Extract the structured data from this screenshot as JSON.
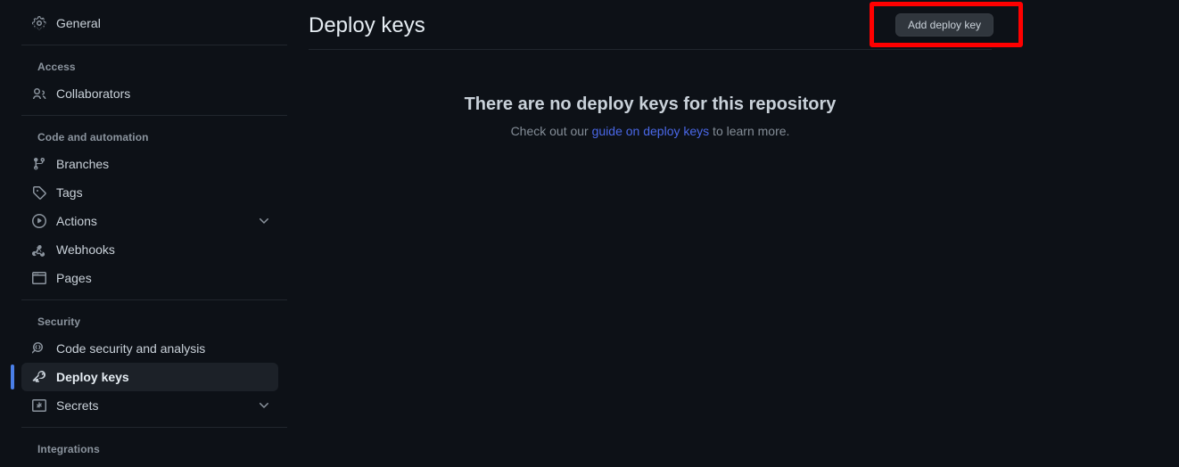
{
  "theme": {
    "background": "#0d1117",
    "selected_background": "#1c2128",
    "accent_bar": "#4a7fe8",
    "link": "#4a68e8",
    "button_background": "#30363d",
    "highlight_border": "#ff0000",
    "border": "#21262d",
    "text_primary": "#e6edf3",
    "text_muted": "#8b949e"
  },
  "sidebar": {
    "sections": [
      {
        "title": null,
        "items": [
          {
            "label": "General",
            "icon": "gear-icon",
            "name": "sidebar-item-general",
            "selected": false,
            "chevron": false
          }
        ]
      },
      {
        "title": "Access",
        "items": [
          {
            "label": "Collaborators",
            "icon": "people-icon",
            "name": "sidebar-item-collaborators",
            "selected": false,
            "chevron": false
          }
        ]
      },
      {
        "title": "Code and automation",
        "items": [
          {
            "label": "Branches",
            "icon": "git-branch-icon",
            "name": "sidebar-item-branches",
            "selected": false,
            "chevron": false
          },
          {
            "label": "Tags",
            "icon": "tag-icon",
            "name": "sidebar-item-tags",
            "selected": false,
            "chevron": false
          },
          {
            "label": "Actions",
            "icon": "play-circle-icon",
            "name": "sidebar-item-actions",
            "selected": false,
            "chevron": true
          },
          {
            "label": "Webhooks",
            "icon": "webhook-icon",
            "name": "sidebar-item-webhooks",
            "selected": false,
            "chevron": false
          },
          {
            "label": "Pages",
            "icon": "browser-icon",
            "name": "sidebar-item-pages",
            "selected": false,
            "chevron": false
          }
        ]
      },
      {
        "title": "Security",
        "items": [
          {
            "label": "Code security and analysis",
            "icon": "code-scan-icon",
            "name": "sidebar-item-code-security-and-analysis",
            "selected": false,
            "chevron": false
          },
          {
            "label": "Deploy keys",
            "icon": "key-icon",
            "name": "sidebar-item-deploy-keys",
            "selected": true,
            "chevron": false
          },
          {
            "label": "Secrets",
            "icon": "asterisk-box-icon",
            "name": "sidebar-item-secrets",
            "selected": false,
            "chevron": true
          }
        ]
      },
      {
        "title": "Integrations",
        "items": []
      }
    ]
  },
  "main": {
    "title": "Deploy keys",
    "add_button_label": "Add deploy key",
    "blankstate": {
      "heading": "There are no deploy keys for this repository",
      "sub_before": "Check out our ",
      "link_text": "guide on deploy keys",
      "sub_after": " to learn more."
    }
  }
}
